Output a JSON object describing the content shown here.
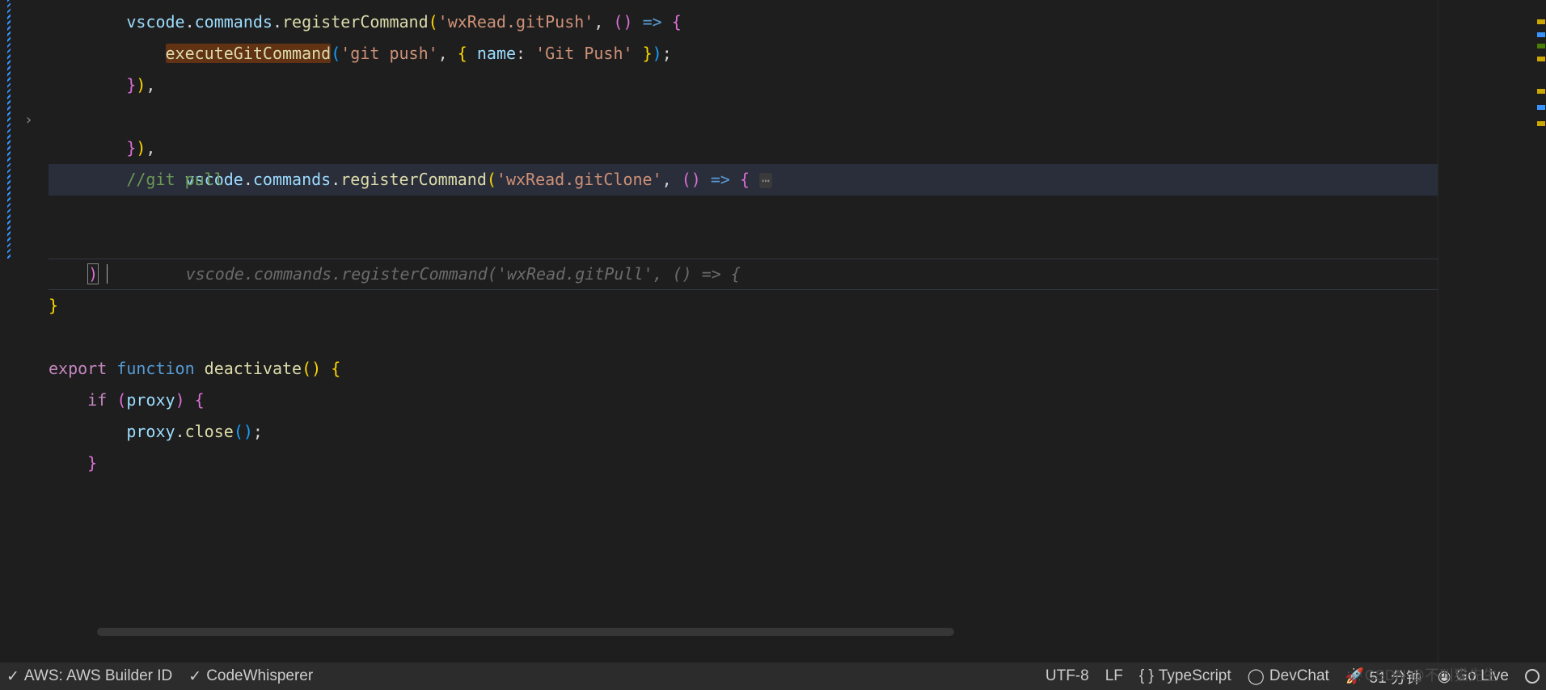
{
  "code": {
    "line1": {
      "indent": "        ",
      "vscode": "vscode",
      "commands": "commands",
      "register": "registerCommand",
      "str": "'wxRead.gitPush'",
      "arrow": "() => {"
    },
    "line2": {
      "indent": "            ",
      "fn": "executeGitCommand",
      "str1": "'git push'",
      "name": "name",
      "str2": "'Git Push'"
    },
    "line3": {
      "indent": "        ",
      "text": "}),"
    },
    "line4": {
      "indent": "        ",
      "vscode": "vscode",
      "commands": "commands",
      "register": "registerCommand",
      "str": "'wxRead.gitClone'",
      "arrow": "() => {"
    },
    "line5": {
      "indent": "        ",
      "text": "}),"
    },
    "line6": {
      "indent": "        ",
      "comment": "//git pull"
    },
    "line7_ghost": "        vscode.commands.registerCommand('wxRead.gitPull', () => {",
    "line9": {
      "indent": "    ",
      "paren": ")"
    },
    "line10": {
      "brace": "}"
    },
    "line12": {
      "export": "export",
      "function": "function",
      "name": "deactivate"
    },
    "line13": {
      "indent": "    ",
      "if": "if",
      "proxy": "proxy"
    },
    "line14": {
      "indent": "        ",
      "proxy": "proxy",
      "close": "close"
    },
    "line15": {
      "indent": "    ",
      "brace": "}"
    }
  },
  "statusbar": {
    "aws": "AWS: AWS Builder ID",
    "whisperer": "CodeWhisperer",
    "encoding": "UTF-8",
    "eol": "LF",
    "language": "TypeScript",
    "devchat": "DevChat",
    "time": "51 分钟",
    "golive": "Go Live"
  },
  "watermark": "CSDN @不叫猫先生"
}
